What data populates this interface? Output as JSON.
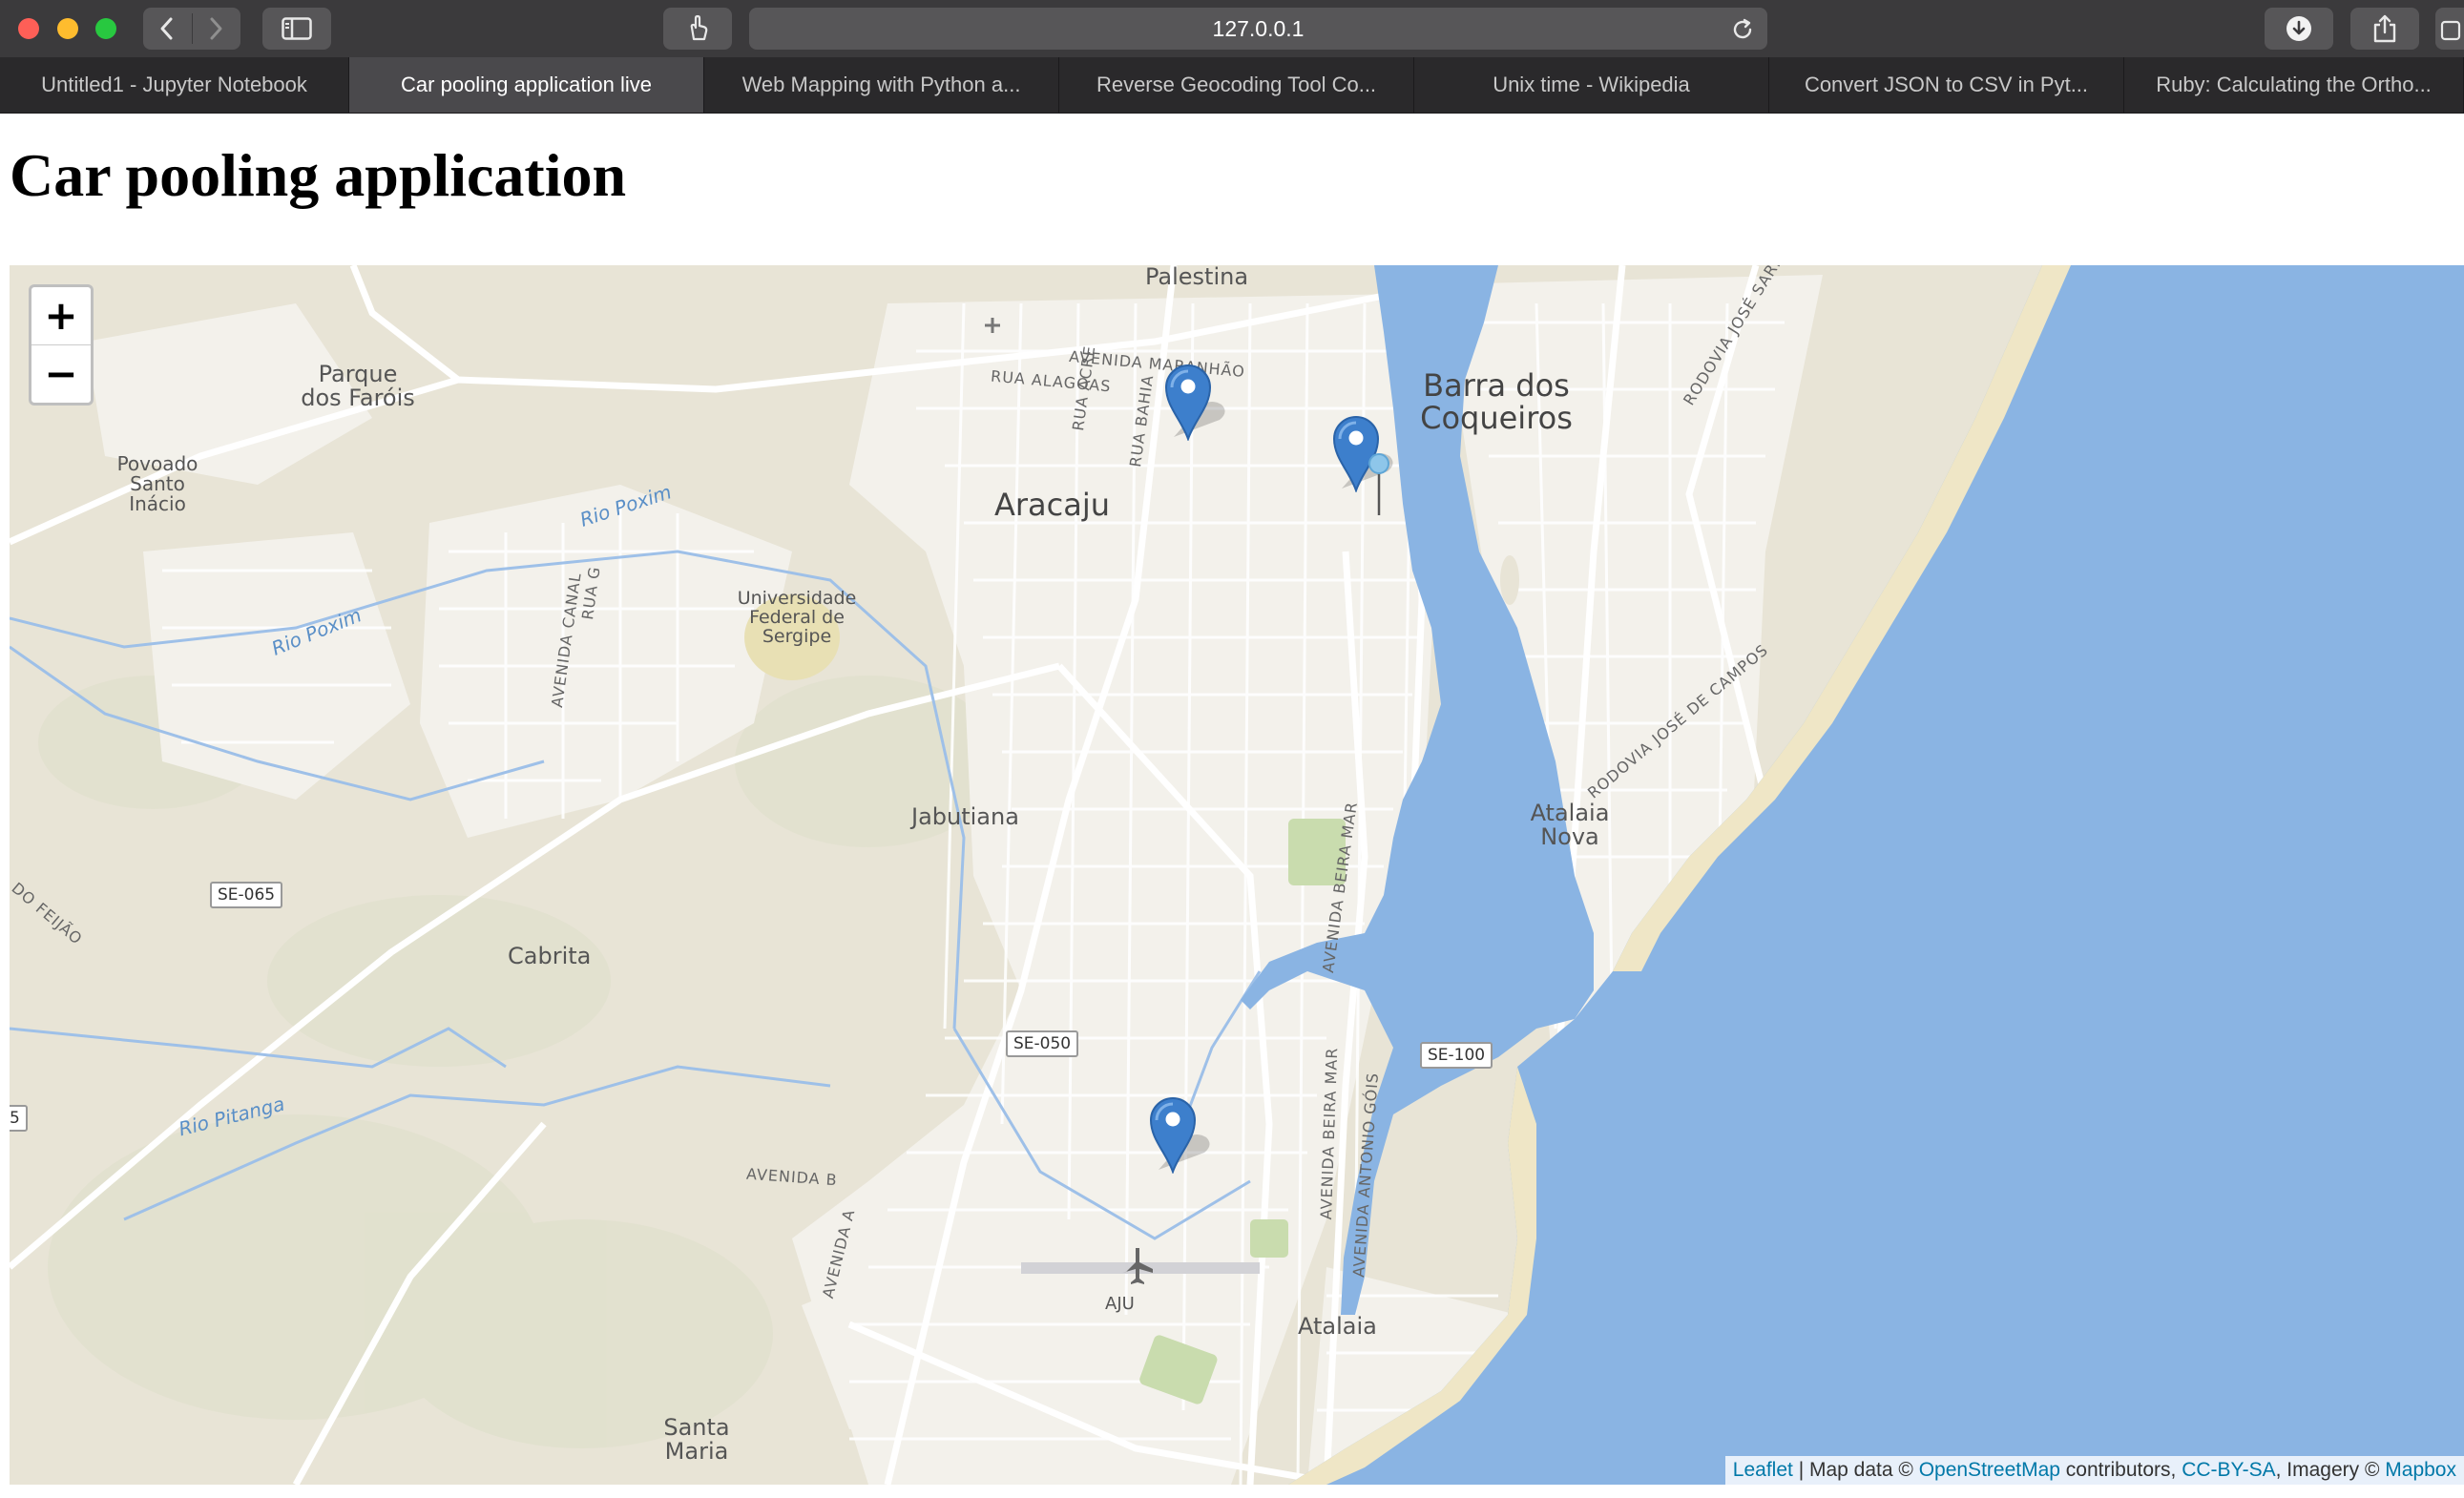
{
  "browser": {
    "url": "127.0.0.1",
    "tabs": [
      {
        "label": "Untitled1 - Jupyter Notebook",
        "active": false
      },
      {
        "label": "Car pooling application live",
        "active": true
      },
      {
        "label": "Web Mapping with Python a...",
        "active": false
      },
      {
        "label": "Reverse Geocoding Tool Co...",
        "active": false
      },
      {
        "label": "Unix time - Wikipedia",
        "active": false
      },
      {
        "label": "Convert JSON to CSV in Pyt...",
        "active": false
      },
      {
        "label": "Ruby: Calculating the Ortho...",
        "active": false
      }
    ]
  },
  "page": {
    "title": "Car pooling application"
  },
  "map": {
    "zoom_in": "+",
    "zoom_out": "−",
    "markers": 3,
    "labels": {
      "palestina": "Palestina",
      "aracaju": "Aracaju",
      "barra_1": "Barra dos",
      "barra_2": "Coqueiros",
      "parque_1": "Parque",
      "parque_2": "dos Faróis",
      "povoado_1": "Povoado",
      "povoado_2": "Santo",
      "povoado_3": "Inácio",
      "univ_1": "Universidade",
      "univ_2": "Federal de",
      "univ_3": "Sergipe",
      "jabutiana": "Jabutiana",
      "cabrita": "Cabrita",
      "atalaia_nova_1": "Atalaia",
      "atalaia_nova_2": "Nova",
      "atalaia": "Atalaia",
      "santa_maria_1": "Santa",
      "santa_maria_2": "Maria",
      "aju": "AJU",
      "rio_poxim_1": "Rio Poxim",
      "rio_poxim_2": "Rio Poxim",
      "rio_pitanga": "Rio Pitanga",
      "do_feijao": "DO FEIJÃO",
      "avenida_maranhao": "AVENIDA MARANHÃO",
      "rua_alagoas": "RUA ALAGOAS",
      "rua_acre": "RUA ACRE",
      "rua_bahia": "RUA BAHIA",
      "avenida_canal": "AVENIDA CANAL",
      "rua_g": "RUA G",
      "avenida_beira_mar_1": "AVENIDA BEIRA MAR",
      "avenida_beira_mar_2": "AVENIDA BEIRA MAR",
      "avenida_antonio_gois": "AVENIDA ANTONIO GÓIS",
      "avenida_b": "AVENIDA B",
      "avenida_a": "AVENIDA A",
      "rodovia_jose_sarney": "RODOVIA JOSÉ SARNEY",
      "rodovia_jose_de_campos": "RODOVIA JOSÉ DE CAMPOS",
      "se065": "SE-065",
      "se050": "SE-050",
      "se100": "SE-100",
      "edge_5": "5"
    },
    "attribution": {
      "leaflet": "Leaflet",
      "sep": " | Map data © ",
      "osm": "OpenStreetMap",
      "contributors": " contributors, ",
      "ccbysa": "CC-BY-SA",
      "imagery": ", Imagery © ",
      "mapbox": "Mapbox"
    },
    "colors": {
      "land": "#e8e4d6",
      "water": "#8ab4e3",
      "urban": "#f2f0ea",
      "marker": "#3d7fcc"
    }
  }
}
